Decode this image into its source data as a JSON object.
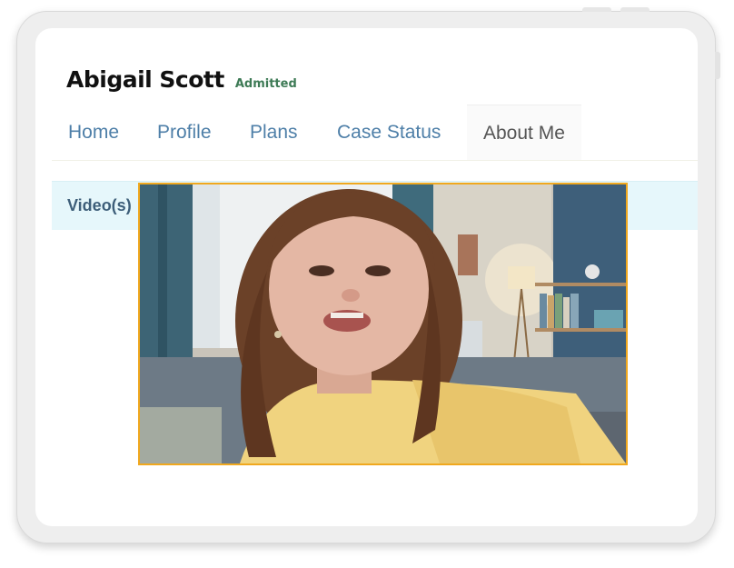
{
  "patient": {
    "name": "Abigail Scott",
    "status": "Admitted"
  },
  "nav": {
    "tabs": [
      {
        "label": "Home",
        "active": false
      },
      {
        "label": "Profile",
        "active": false
      },
      {
        "label": "Plans",
        "active": false
      },
      {
        "label": "Case Status",
        "active": false
      },
      {
        "label": "About Me",
        "active": true
      }
    ]
  },
  "videos": {
    "section_label": "Video(s)"
  },
  "colors": {
    "accent_border": "#f0a81e",
    "link": "#4e7fa8",
    "status": "#3d7a55"
  }
}
